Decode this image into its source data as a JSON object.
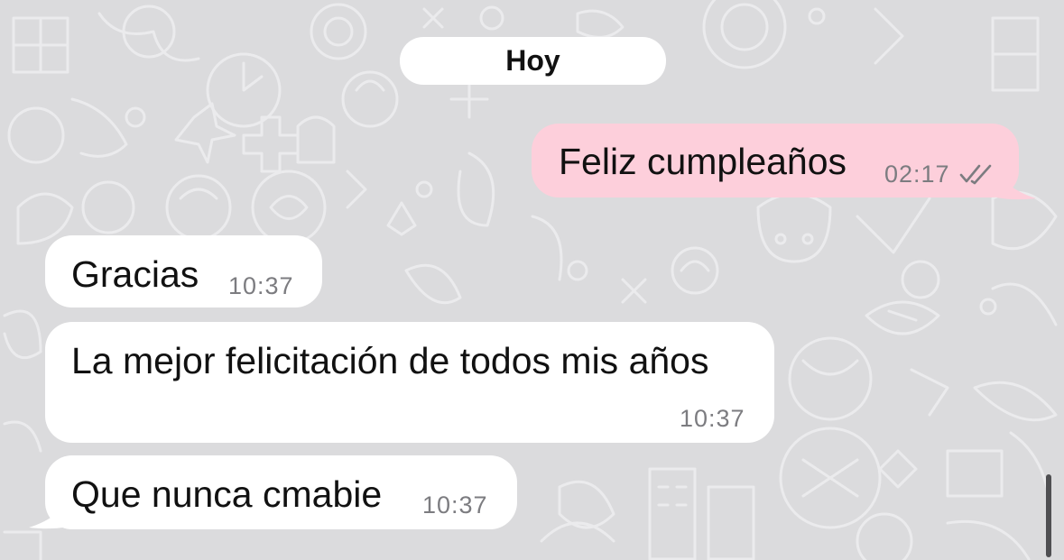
{
  "chat": {
    "date_label": "Hoy",
    "messages": [
      {
        "direction": "outgoing",
        "text": "Feliz cumpleaños",
        "time": "02:17",
        "status": "read"
      },
      {
        "direction": "incoming",
        "text": "Gracias",
        "time": "10:37"
      },
      {
        "direction": "incoming",
        "text": "La mejor felicitación de todos mis años",
        "time": "10:37"
      },
      {
        "direction": "incoming",
        "text": "Que nunca cmabie",
        "time": "10:37"
      }
    ]
  },
  "icons": {
    "read_receipt": "double-check-icon"
  },
  "colors": {
    "background": "#dbdbdd",
    "incoming_bubble": "#ffffff",
    "outgoing_bubble": "#fdcfdb",
    "wallpaper_doodle": "#eaeaec",
    "text": "#111111",
    "timestamp": "#7c7c80"
  }
}
